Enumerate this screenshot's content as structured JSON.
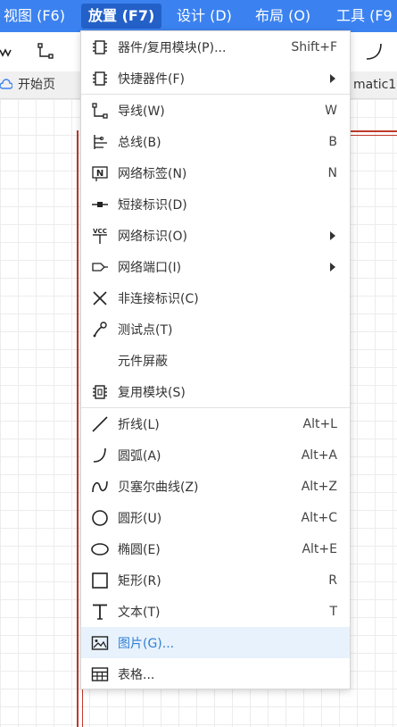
{
  "menubar": {
    "items": [
      "视图 (F6)",
      "放置 (F7)",
      "设计 (D)",
      "布局 (O)",
      "工具 (F9"
    ]
  },
  "tabs": {
    "home": "开始页",
    "schematic": "matic1"
  },
  "menu": {
    "items": [
      {
        "label": "器件/复用模块(P)...",
        "shortcut": "Shift+F",
        "icon": "component-chip-icon"
      },
      {
        "label": "快捷器件(F)",
        "submenu": true,
        "icon": "chip-icon"
      },
      {
        "label": "导线(W)",
        "shortcut": "W",
        "icon": "wire-icon"
      },
      {
        "label": "总线(B)",
        "shortcut": "B",
        "icon": "bus-icon"
      },
      {
        "label": "网络标签(N)",
        "shortcut": "N",
        "icon": "net-label-icon"
      },
      {
        "label": "短接标识(D)",
        "icon": "short-flag-icon"
      },
      {
        "label": "网络标识(O)",
        "submenu": true,
        "icon": "net-flag-vcc-icon",
        "icon_text": "VCC"
      },
      {
        "label": "网络端口(I)",
        "submenu": true,
        "icon": "net-port-icon"
      },
      {
        "label": "非连接标识(C)",
        "icon": "no-connect-icon"
      },
      {
        "label": "测试点(T)",
        "icon": "test-point-icon"
      },
      {
        "label": "元件屏蔽",
        "icon": ""
      },
      {
        "label": "复用模块(S)",
        "icon": "reuse-block-icon"
      },
      {
        "label": "折线(L)",
        "shortcut": "Alt+L",
        "icon": "polyline-icon"
      },
      {
        "label": "圆弧(A)",
        "shortcut": "Alt+A",
        "icon": "arc-icon"
      },
      {
        "label": "贝塞尔曲线(Z)",
        "shortcut": "Alt+Z",
        "icon": "bezier-icon"
      },
      {
        "label": "圆形(U)",
        "shortcut": "Alt+C",
        "icon": "circle-icon"
      },
      {
        "label": "椭圆(E)",
        "shortcut": "Alt+E",
        "icon": "ellipse-icon"
      },
      {
        "label": "矩形(R)",
        "shortcut": "R",
        "icon": "rectangle-icon"
      },
      {
        "label": "文本(T)",
        "shortcut": "T",
        "icon": "text-icon"
      },
      {
        "label": "图片(G)...",
        "icon": "image-icon",
        "highlighted": true
      },
      {
        "label": "表格...",
        "icon": "table-icon"
      }
    ]
  },
  "colors": {
    "menubar_bg": "#3b82f0",
    "highlight_bg": "#e8f2fc",
    "highlight_text": "#2f7fd5",
    "schematic_border": "#c0392b"
  }
}
